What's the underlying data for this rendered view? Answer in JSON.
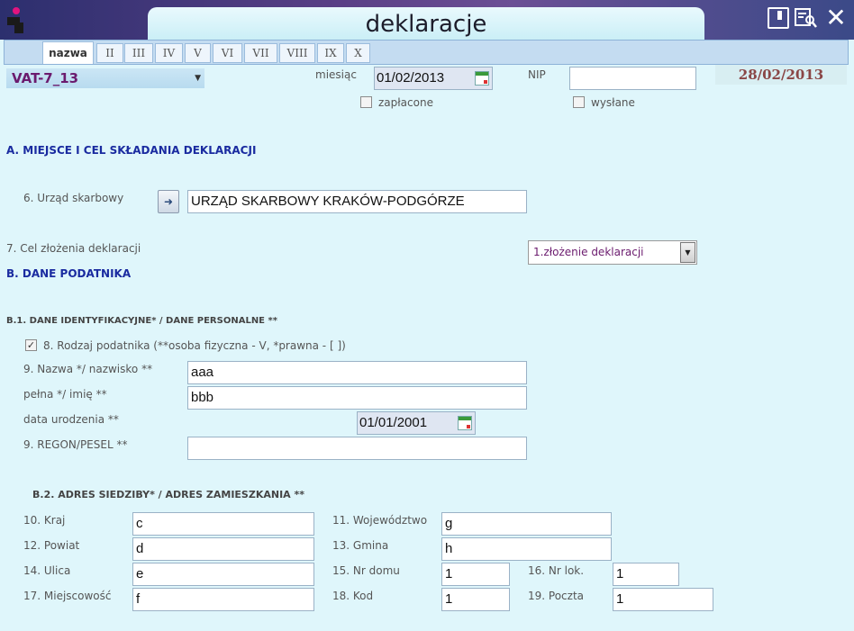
{
  "window": {
    "title": "deklaracje"
  },
  "tabs": [
    "nazwa",
    "II",
    "III",
    "IV",
    "V",
    "VI",
    "VII",
    "VIII",
    "IX",
    "X"
  ],
  "header": {
    "form_type": "VAT-7_13",
    "month_label": "miesiąc",
    "month_value": "01/02/2013",
    "nip_label": "NIP",
    "nip_value": "",
    "date_right": "28/02/2013",
    "paid_label": "zapłacone",
    "sent_label": "wysłane"
  },
  "section_a": {
    "title": "A. MIEJSCE I CEL SKŁADANIA DEKLARACJI",
    "office_label": "6. Urząd skarbowy",
    "office_value": "URZĄD SKARBOWY KRAKÓW-PODGÓRZE",
    "purpose_label": "7. Cel złożenia deklaracji",
    "purpose_value": "1.złożenie deklaracji"
  },
  "section_b": {
    "title": "B. DANE PODATNIKA",
    "b1_title": "B.1. DANE IDENTYFIKACYJNE* / DANE PERSONALNE **",
    "taxpayer_type_label": "8. Rodzaj podatnika (**osoba fizyczna - V, *prawna - [ ])",
    "name_label": "9. Nazwa */ nazwisko **",
    "name_value": "aaa",
    "fullname_label": "pełna */ imię **",
    "fullname_value": "bbb",
    "birth_label": "data urodzenia **",
    "birth_value": "01/01/2001",
    "regon_label": "9. REGON/PESEL **",
    "regon_value": "",
    "b2_title": "B.2. ADRES SIEDZIBY* / ADRES ZAMIESZKANIA **"
  },
  "address": {
    "country_label": "10. Kraj",
    "country_value": "c",
    "voivodeship_label": "11. Województwo",
    "voivodeship_value": "g",
    "district_label": "12. Powiat",
    "district_value": "d",
    "commune_label": "13. Gmina",
    "commune_value": "h",
    "street_label": "14. Ulica",
    "street_value": "e",
    "house_label": "15. Nr domu",
    "house_value": "1",
    "apt_label": "16. Nr lok.",
    "apt_value": "1",
    "city_label": "17. Miejscowość",
    "city_value": "f",
    "postal_label": "18. Kod",
    "postal_value": "1",
    "post_label": "19. Poczta",
    "post_value": "1"
  },
  "colors": {
    "title_bar": "#5a3f86",
    "section_title": "#1a2ba0",
    "form_type": "#6b1b6e",
    "date_right": "#8a4646"
  }
}
